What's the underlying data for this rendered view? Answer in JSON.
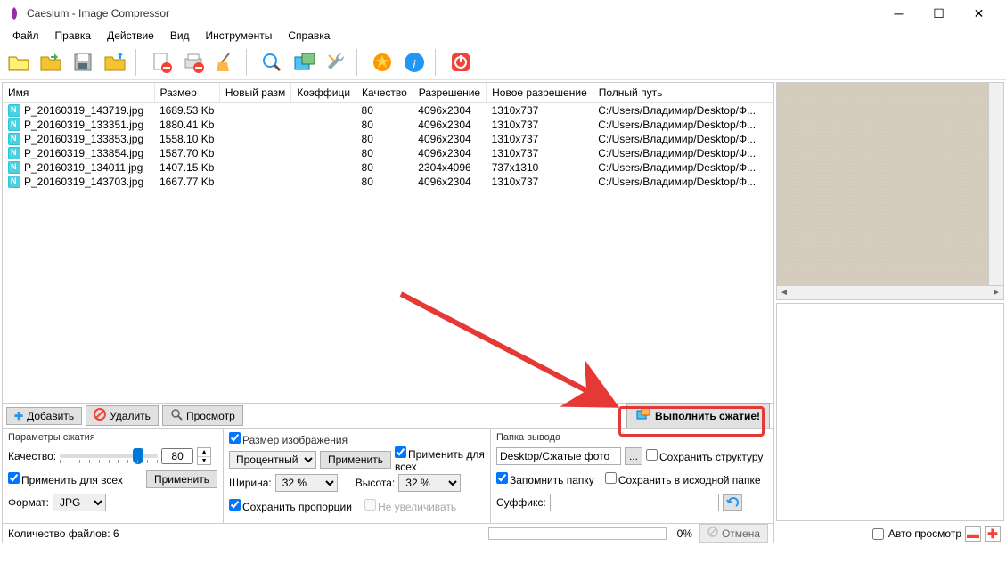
{
  "window": {
    "title": "Caesium - Image Compressor"
  },
  "menu": [
    "Файл",
    "Правка",
    "Действие",
    "Вид",
    "Инструменты",
    "Справка"
  ],
  "columns": [
    "Имя",
    "Размер",
    "Новый разм",
    "Коэффици",
    "Качество",
    "Разрешение",
    "Новое разрешение",
    "Полный путь"
  ],
  "rows": [
    {
      "name": "P_20160319_143719.jpg",
      "size": "1689.53 Kb",
      "newsize": "",
      "ratio": "",
      "q": "80",
      "res": "4096x2304",
      "newres": "1310x737",
      "path": "C:/Users/Владимир/Desktop/Ф..."
    },
    {
      "name": "P_20160319_133351.jpg",
      "size": "1880.41 Kb",
      "newsize": "",
      "ratio": "",
      "q": "80",
      "res": "4096x2304",
      "newres": "1310x737",
      "path": "C:/Users/Владимир/Desktop/Ф..."
    },
    {
      "name": "P_20160319_133853.jpg",
      "size": "1558.10 Kb",
      "newsize": "",
      "ratio": "",
      "q": "80",
      "res": "4096x2304",
      "newres": "1310x737",
      "path": "C:/Users/Владимир/Desktop/Ф..."
    },
    {
      "name": "P_20160319_133854.jpg",
      "size": "1587.70 Kb",
      "newsize": "",
      "ratio": "",
      "q": "80",
      "res": "4096x2304",
      "newres": "1310x737",
      "path": "C:/Users/Владимир/Desktop/Ф..."
    },
    {
      "name": "P_20160319_134011.jpg",
      "size": "1407.15 Kb",
      "newsize": "",
      "ratio": "",
      "q": "80",
      "res": "2304x4096",
      "newres": "737x1310",
      "path": "C:/Users/Владимир/Desktop/Ф..."
    },
    {
      "name": "P_20160319_143703.jpg",
      "size": "1667.77 Kb",
      "newsize": "",
      "ratio": "",
      "q": "80",
      "res": "4096x2304",
      "newres": "1310x737",
      "path": "C:/Users/Владимир/Desktop/Ф..."
    }
  ],
  "actions": {
    "add": "Добавить",
    "remove": "Удалить",
    "preview": "Просмотр",
    "compress": "Выполнить сжатие!"
  },
  "params": {
    "title": "Параметры сжатия",
    "quality_label": "Качество:",
    "quality_value": "80",
    "apply_all": "Применить для всех",
    "apply_btn": "Применить",
    "format_label": "Формат:",
    "format_value": "JPG"
  },
  "resize": {
    "title": "Размер изображения",
    "mode": "Процентный",
    "apply_btn": "Применить",
    "apply_all": "Применить для всех",
    "width_label": "Ширина:",
    "width_val": "32 %",
    "height_label": "Высота:",
    "height_val": "32 %",
    "keep_prop": "Сохранить пропорции",
    "no_enlarge": "Не увеличивать"
  },
  "output": {
    "title": "Папка вывода",
    "path": "Desktop/Сжатые фото",
    "browse": "...",
    "keep_struct": "Сохранить структуру",
    "remember": "Запомнить папку",
    "same_folder": "Сохранить в исходной папке",
    "suffix_label": "Суффикс:",
    "suffix_val": ""
  },
  "status": {
    "count": "Количество файлов: 6",
    "cancel": "Отмена",
    "percent": "0%"
  },
  "preview": {
    "auto": "Авто просмотр"
  }
}
